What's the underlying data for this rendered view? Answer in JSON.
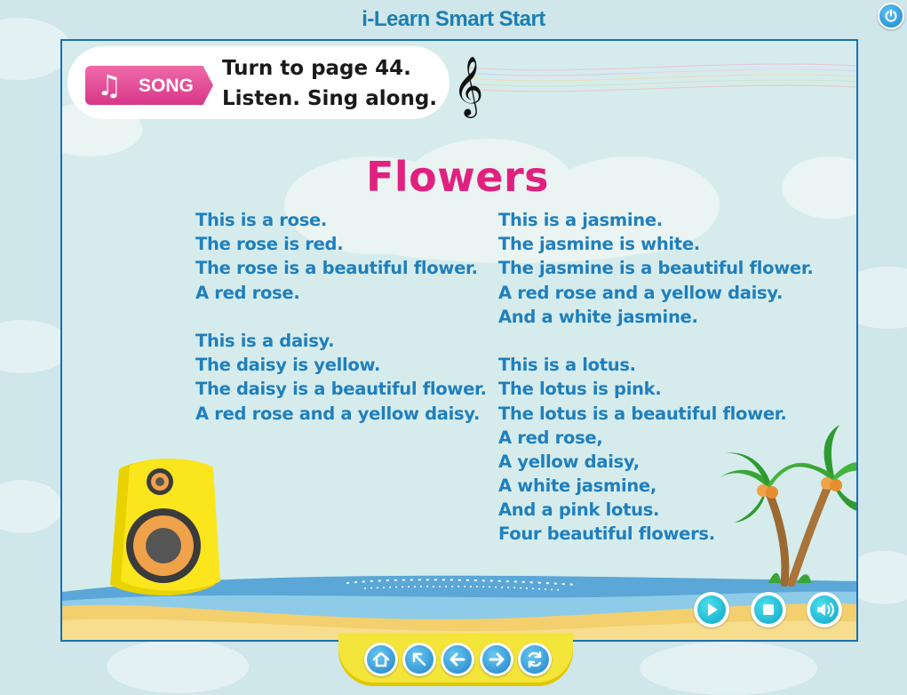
{
  "app": {
    "title": "i-Learn Smart Start"
  },
  "instruction": {
    "badge_label": "SONG",
    "badge_icon": "music-note-icon",
    "line1": "Turn to page 44.",
    "line2": "Listen. Sing along."
  },
  "song": {
    "title": "Flowers",
    "left_column": [
      "This is a rose.",
      "The rose is red.",
      "The rose is a beautiful flower.",
      "A red rose.",
      "",
      "This is a daisy.",
      "The daisy is yellow.",
      "The daisy is a beautiful flower.",
      "A red rose and a yellow daisy."
    ],
    "right_column": [
      "This is a jasmine.",
      "The jasmine is white.",
      "The jasmine is a beautiful flower.",
      "A red rose and a yellow daisy.",
      "And a white jasmine.",
      "",
      "This is a lotus.",
      "The lotus is pink.",
      "The lotus is a beautiful flower.",
      "A red rose,",
      "A yellow daisy,",
      "A white jasmine,",
      "And a pink lotus.",
      "Four beautiful flowers."
    ]
  },
  "controls": {
    "play": "play-icon",
    "stop": "stop-icon",
    "volume": "volume-icon"
  },
  "nav": [
    "home-icon",
    "back-to-menu-icon",
    "previous-icon",
    "next-icon",
    "replay-icon"
  ],
  "colors": {
    "title_pink": "#e0217f",
    "lyrics_blue": "#1f7fbd",
    "frame_blue": "#1a6fb5",
    "badge_pink": "#e04a93",
    "nav_yellow": "#f4e53a"
  }
}
